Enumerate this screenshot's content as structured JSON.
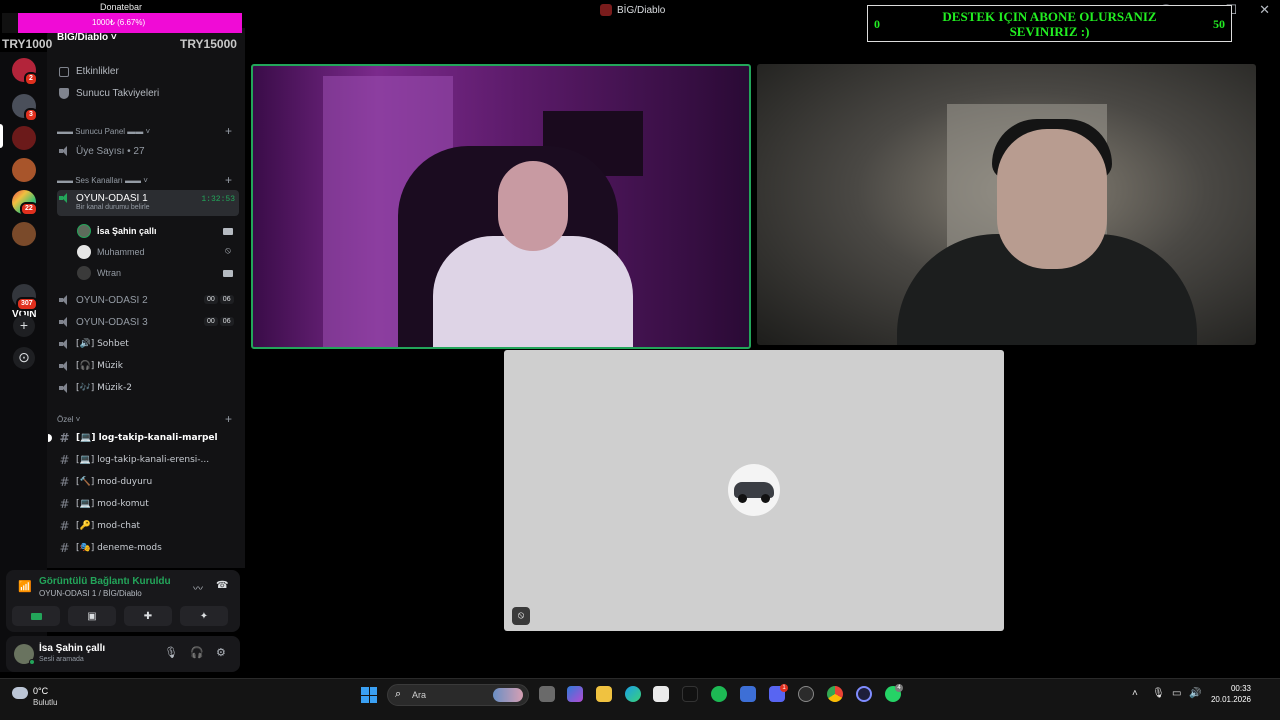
{
  "window": {
    "title": "BİG/Diablo"
  },
  "overlay_donate": {
    "title": "Donatebar",
    "progress_text": "1000₺ (6.67%)",
    "progress_fraction": 0.0667,
    "min_label": "TRY1000",
    "max_label": "TRY15000"
  },
  "overlay_subscribe": {
    "left_value": "0",
    "right_value": "50",
    "text": "DESTEK IÇIN ABONE OLURSANIZ SEVINIRIZ :)"
  },
  "server": {
    "name": "BİG/Diablo"
  },
  "rail": {
    "badges": [
      "2",
      "3",
      "22",
      "307"
    ],
    "text_server": "VOİN"
  },
  "menu": {
    "events": "Etkinlikler",
    "boosts": "Sunucu Takviyeleri"
  },
  "categories": {
    "panel": "▬▬ Sunucu Panel ▬▬",
    "voice": "▬▬ Ses Kanalları ▬▬",
    "private": "Özel"
  },
  "member_count_channel": "Üye Sayısı • 27",
  "active_voice": {
    "name": "OYUN-ODASI 1",
    "timer": "1:32:53",
    "status": "Bir kanal durumu belirle",
    "members": [
      "İsa Şahin çallı",
      "Muhammed",
      "Wtran"
    ]
  },
  "voice_channels": [
    {
      "name": "OYUN-ODASI 2",
      "count_a": "00",
      "count_b": "06"
    },
    {
      "name": "OYUN-ODASI 3",
      "count_a": "00",
      "count_b": "06"
    },
    {
      "name": "[🔊] Sohbet"
    },
    {
      "name": "[🎧] Müzik"
    },
    {
      "name": "[🎶] Müzik-2"
    }
  ],
  "text_channels": [
    "[💻] log-takip-kanali-marpel",
    "[💻] log-takip-kanali-erensi-...",
    "[🔨] mod-duyuru",
    "[💻] mod-komut",
    "[🔑] mod-chat",
    "[🎭] deneme-mods"
  ],
  "connection": {
    "title": "Görüntülü Bağlantı Kuruldu",
    "subtitle": "OYUN-ODASI 1 / BİG/Diablo"
  },
  "user": {
    "name": "İsa Şahin çallı",
    "status": "Sesli aramada"
  },
  "taskbar": {
    "weather_temp": "0°C",
    "weather_desc": "Bulutlu",
    "search_placeholder": "Ara",
    "time": "00:33",
    "date": "20.01.2026",
    "discord_badge": "1",
    "whatsapp_badge": "4"
  },
  "colors": {
    "accent_green": "#23a55a",
    "overlay_pink": "#f00bd6",
    "overlay_green": "#22ee22"
  }
}
